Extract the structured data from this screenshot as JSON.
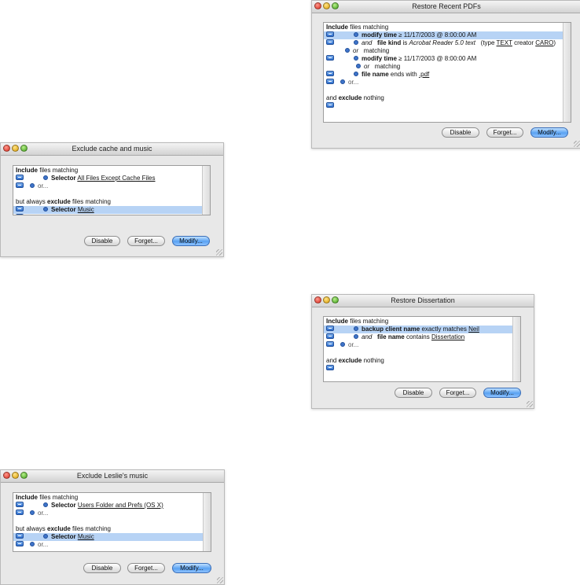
{
  "buttons": {
    "disable": "Disable",
    "forget": "Forget...",
    "modify": "Modify..."
  },
  "w1": {
    "title": "Exclude cache and music",
    "include": "Include",
    "files_matching": " files matching",
    "selector": "Selector",
    "sel1_value": "All Files Except Cache Files",
    "or": "or...",
    "but_always": "but always ",
    "exclude": "exclude",
    "files_matching2": " files matching",
    "sel2_value": "Music"
  },
  "w2": {
    "title": "Restore Recent PDFs",
    "include": "Include",
    "files_matching": " files matching",
    "modify_time": "modify time",
    "ge_date": " ≥ 11/17/2003 @ 8:00:00 AM",
    "and": "and",
    "file_kind": "file kind",
    "is": " is ",
    "acrobat": "Acrobat Reader 5.0 text",
    "type_pre": "(type ",
    "type_val": "TEXT",
    "creator": " creator ",
    "creator_val": "CARO",
    "close_paren": ")",
    "or": "or",
    "matching": "matching",
    "modify_time2": "modify time",
    "ge_date2": " ≥ 11/17/2003 @ 8:00:00 AM",
    "or2": "or",
    "matching2": "matching",
    "file_name": "file name",
    "ends_with": " ends with ",
    "ext": ".pdf",
    "or_dots": "or...",
    "and_exclude": "and ",
    "exclude": "exclude",
    "nothing": " nothing"
  },
  "w3": {
    "title": "Restore Dissertation",
    "include": "Include",
    "files_matching": " files matching",
    "backup_client": "backup client name",
    "exactly": " exactly matches ",
    "neil": "Neil",
    "and": "and",
    "file_name": "file name",
    "contains": " contains ",
    "dissertation": "Dissertation",
    "or_dots": "or...",
    "and_exclude": "and ",
    "exclude": "exclude",
    "nothing": " nothing"
  },
  "w4": {
    "title": "Exclude Leslie's music",
    "include": "Include",
    "files_matching": " files matching",
    "selector": "Selector",
    "sel1_value": "Users Folder and Prefs (OS X)",
    "or": "or...",
    "but_always": "but always ",
    "exclude": "exclude",
    "files_matching2": " files matching",
    "sel2_value": "Music"
  }
}
